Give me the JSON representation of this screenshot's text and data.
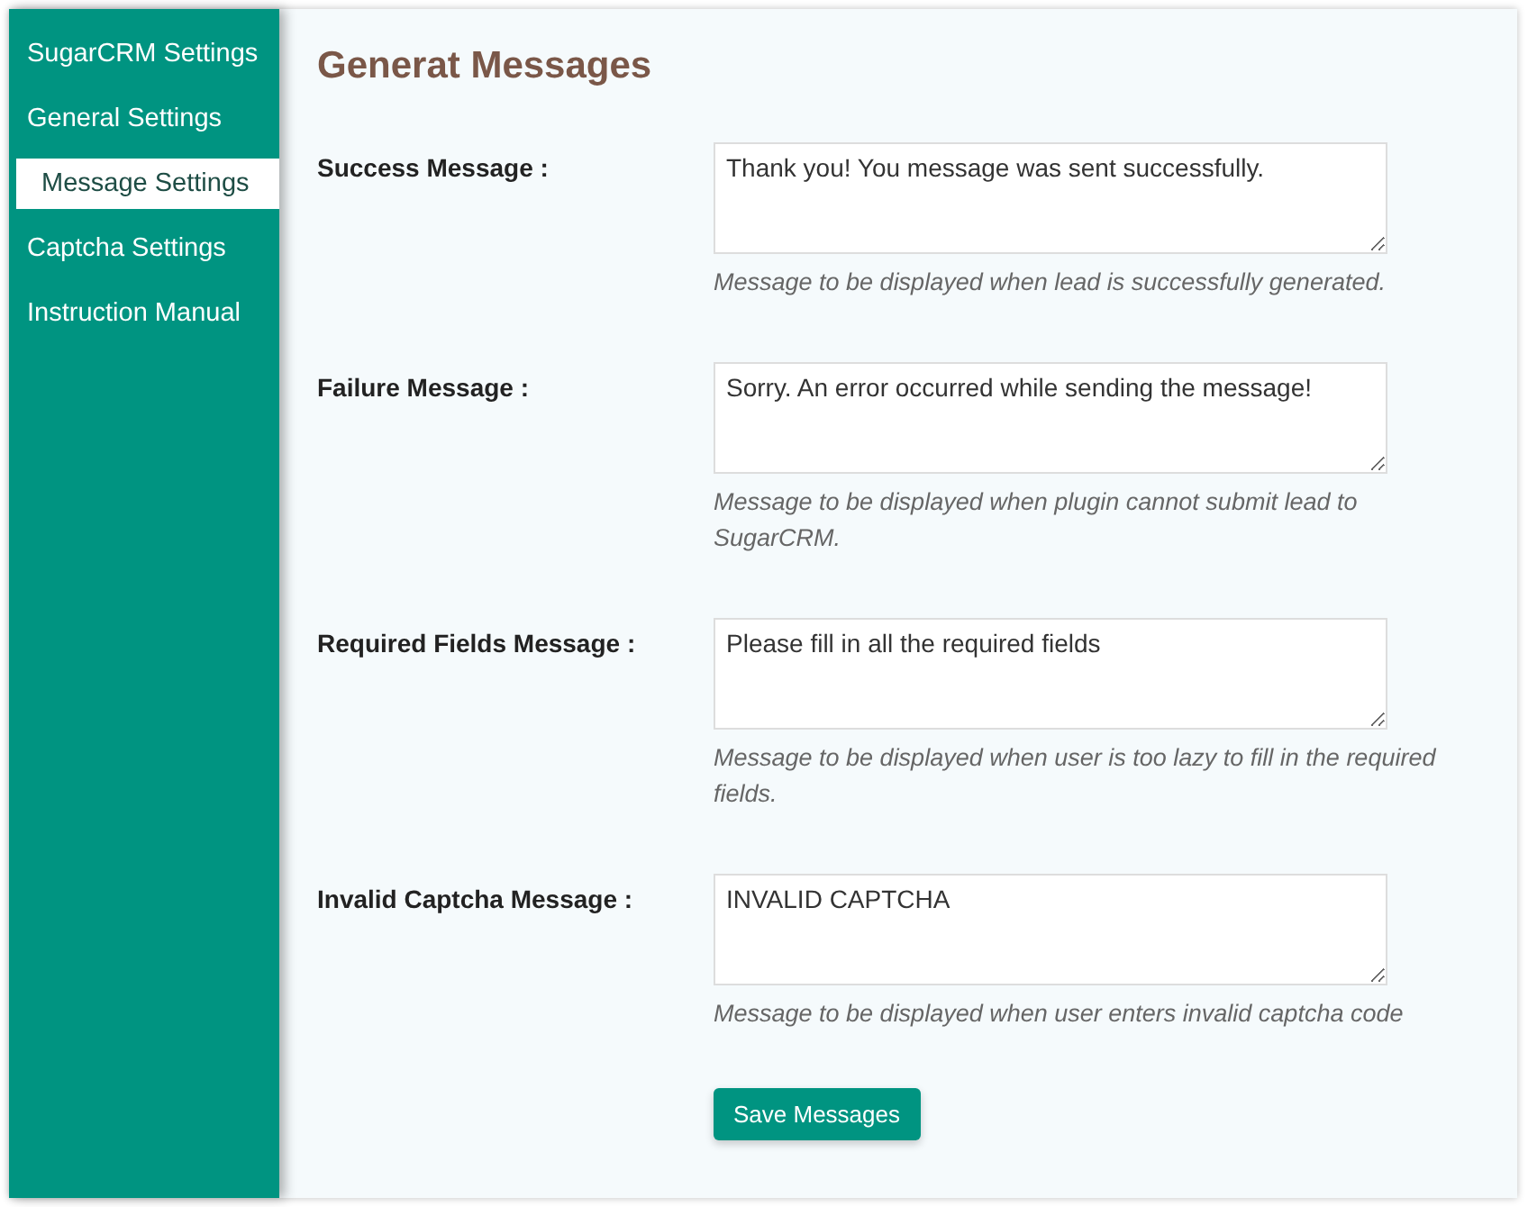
{
  "sidebar": {
    "items": [
      {
        "label": "SugarCRM Settings",
        "selected": false
      },
      {
        "label": "General Settings",
        "selected": false
      },
      {
        "label": "Message Settings",
        "selected": true
      },
      {
        "label": "Captcha Settings",
        "selected": false
      },
      {
        "label": "Instruction Manual",
        "selected": false
      }
    ]
  },
  "title": "Generat Messages",
  "fields": [
    {
      "label": "Success Message :",
      "value": "Thank you! You message was sent successfully.",
      "help": "Message to be displayed when lead is successfully generated."
    },
    {
      "label": "Failure Message :",
      "value": "Sorry. An error occurred while sending the message!",
      "help": "Message to be displayed when plugin cannot submit lead to SugarCRM."
    },
    {
      "label": "Required Fields Message :",
      "value": "Please fill in all the required fields",
      "help": "Message to be displayed when user is too lazy to fill in the required fields."
    },
    {
      "label": "Invalid Captcha Message :",
      "value": "INVALID CAPTCHA",
      "help": "Message to be displayed when user enters invalid captcha code"
    }
  ],
  "save_button": "Save Messages"
}
